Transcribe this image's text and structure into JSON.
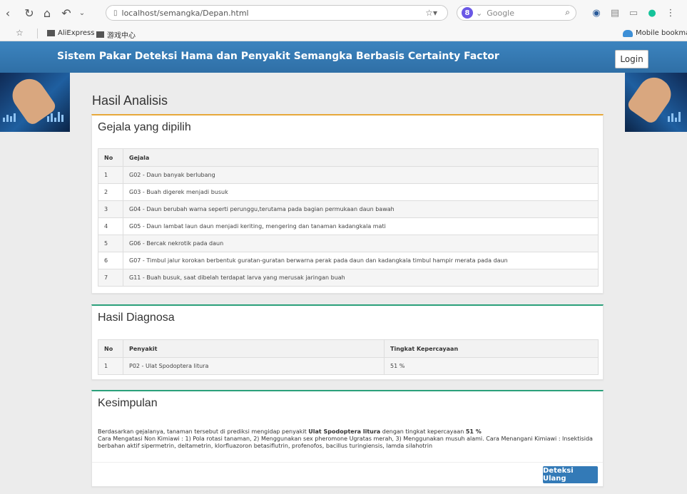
{
  "browser": {
    "url": "localhost/semangka/Depan.html",
    "search_placeholder": "Google",
    "search_engine_badge": "8",
    "bookmarks": [
      "AliExpress",
      "游戏中心"
    ],
    "mobile_bookmarks": "Mobile bookmark"
  },
  "header": {
    "site_title": "Sistem Pakar Deteksi Hama dan Penyakit Semangka Berbasis Certainty Factor",
    "login_label": "Login"
  },
  "main": {
    "heading": "Hasil Analisis"
  },
  "symptoms": {
    "title": "Gejala yang dipilih",
    "columns": [
      "No",
      "Gejala"
    ],
    "rows": [
      [
        "1",
        "G02 - Daun banyak berlubang"
      ],
      [
        "2",
        "G03 - Buah digerek menjadi busuk"
      ],
      [
        "3",
        "G04 - Daun berubah warna seperti perunggu,terutama pada bagian permukaan daun bawah"
      ],
      [
        "4",
        "G05 - Daun lambat laun daun menjadi keriting, mengering dan tanaman kadangkala mati"
      ],
      [
        "5",
        "G06 - Bercak nekrotik pada daun"
      ],
      [
        "6",
        "G07 - Timbul jalur korokan berbentuk guratan-guratan berwarna perak pada daun dan kadangkala timbul hampir merata pada daun"
      ],
      [
        "7",
        "G11 - Buah busuk, saat dibelah terdapat larva yang merusak jaringan buah"
      ]
    ]
  },
  "diagnosis": {
    "title": "Hasil Diagnosa",
    "columns": [
      "No",
      "Penyakit",
      "Tingkat Kepercayaan"
    ],
    "rows": [
      [
        "1",
        "P02 - Ulat Spodoptera litura",
        "51 %"
      ]
    ]
  },
  "conclusion": {
    "title": "Kesimpulan",
    "intro": "Berdasarkan gejalanya, tanaman tersebut di prediksi mengidap penyakit ",
    "disease": "Ulat Spodoptera litura",
    "mid": " dengan tingkat kepercayaan ",
    "confidence": "51 %",
    "treatment": "Cara Mengatasi Non Kimiawi : 1) Pola rotasi tanaman, 2) Menggunakan sex pheromone Ugratas merah, 3) Menggunakan musuh alami. Cara Menangani Kimiawi : Insektisida berbahan aktif sipermetrin, deltametrin, klorfluazoron betasiflutrin, profenofos, bacillus turingiensis, lamda silahotrin",
    "redo_label": "Deteksi Ulang"
  },
  "colors": {
    "header_blue": "#337ab7",
    "accent_orange": "#e7a83a",
    "accent_green": "#2aa07a"
  }
}
